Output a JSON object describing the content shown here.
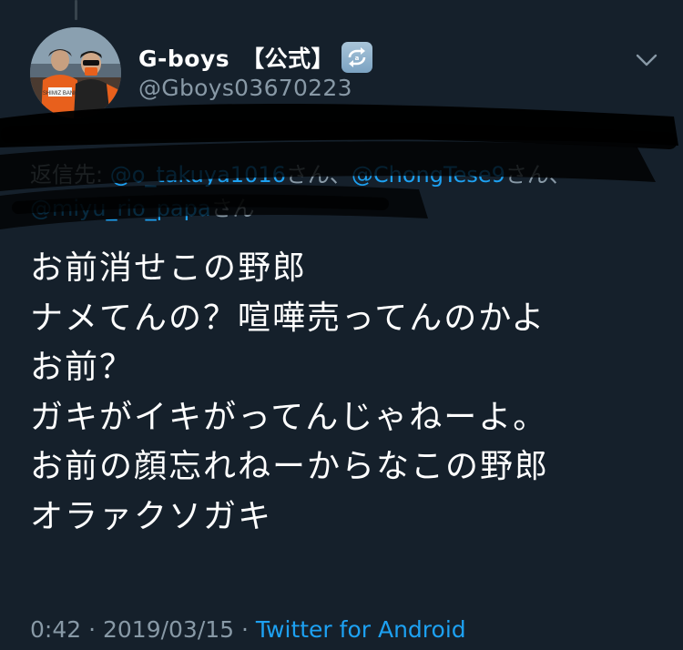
{
  "colors": {
    "background": "#15202b",
    "primary_text": "#ffffff",
    "secondary_text": "#8899a6",
    "link": "#1da1f2",
    "scribble": "#000000"
  },
  "author": {
    "display_name": "G-boys　【公式】",
    "handle": "@Gboys03670223",
    "badge_icon": "repeat-arrows-icon",
    "avatar_jersey_text": "SHIMIZ BANK"
  },
  "menu": {
    "icon": "chevron-down-icon"
  },
  "reply": {
    "prefix": "返信先: ",
    "mention_1": "@o_takuya1016",
    "suffix_1": "さん、",
    "mention_2": "@ChongTese9",
    "suffix_2": "さん、",
    "mention_3": "@miyu_rio_papa",
    "suffix_3": "さん"
  },
  "tweet": {
    "lines": [
      "お前消せこの野郎",
      "ナメてんの？喧嘩売ってんのかよ",
      "お前？",
      "ガキがイキがってんじゃねーよ。",
      "お前の顔忘れねーからなこの野郎",
      "オラァクソガキ"
    ]
  },
  "meta": {
    "time": "0:42",
    "separator_1": " · ",
    "date": "2019/03/15",
    "separator_2": " · ",
    "source": "Twitter for Android"
  }
}
